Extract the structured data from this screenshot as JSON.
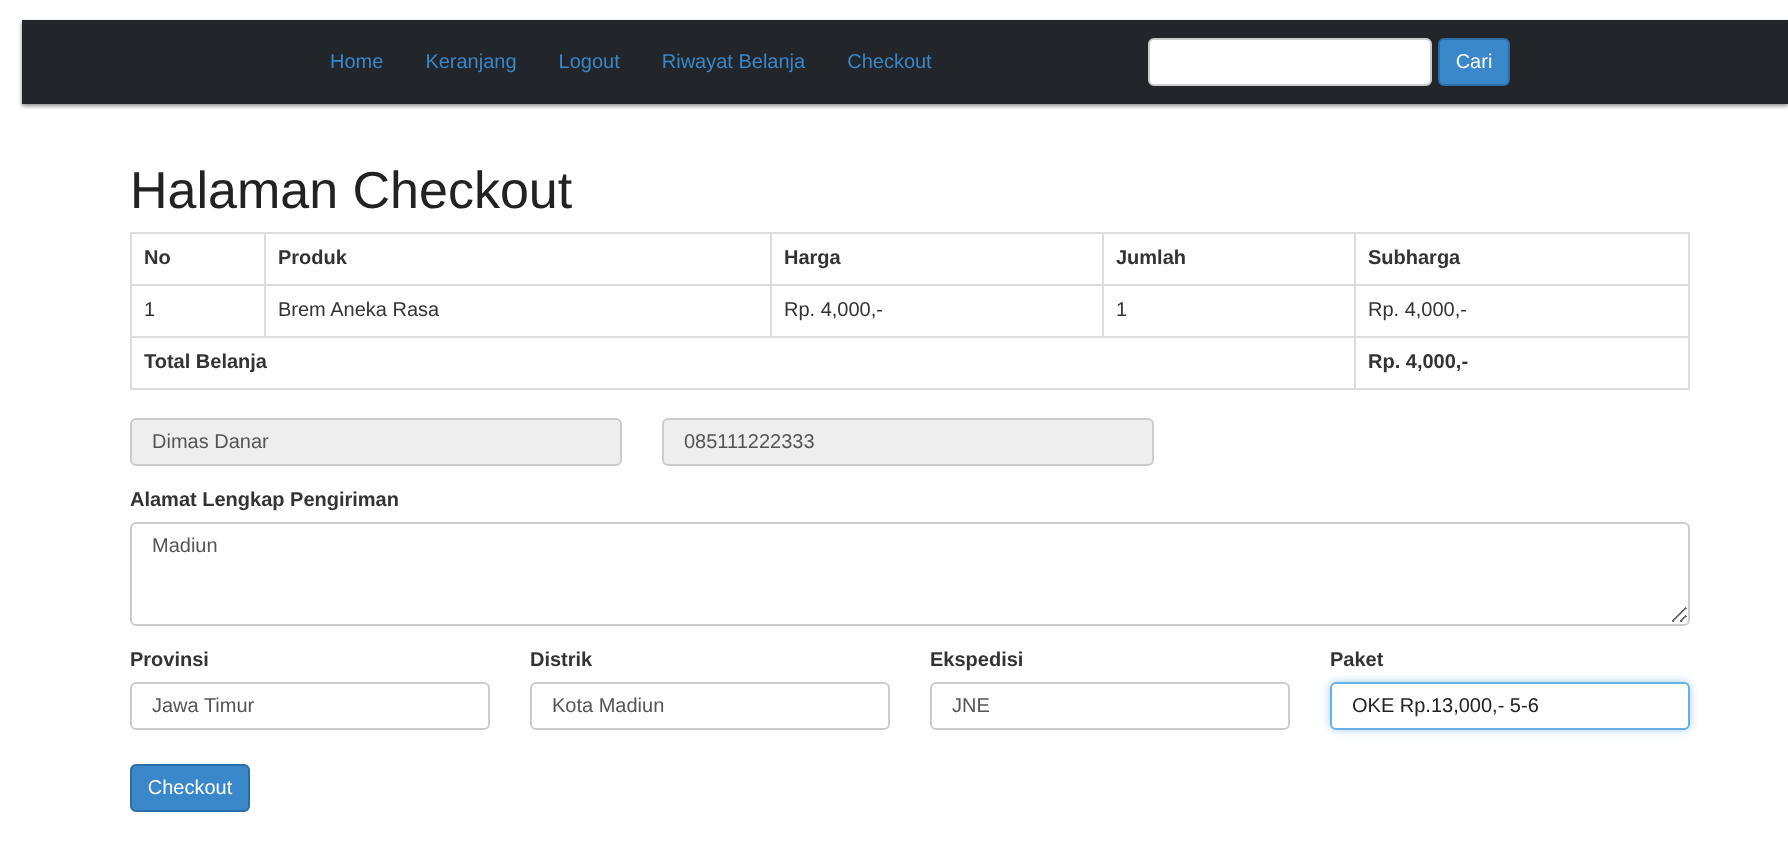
{
  "navbar": {
    "links": [
      "Home",
      "Keranjang",
      "Logout",
      "Riwayat Belanja",
      "Checkout"
    ],
    "search": {
      "button": "Cari"
    }
  },
  "title": "Halaman Checkout",
  "table": {
    "columns": [
      "No",
      "Produk",
      "Harga",
      "Jumlah",
      "Subharga"
    ],
    "rows": [
      [
        "1",
        "Brem Aneka Rasa",
        "Rp. 4,000,-",
        "1",
        "Rp. 4,000,-"
      ]
    ],
    "total": {
      "label": "Total Belanja",
      "value": "Rp. 4,000,-"
    }
  },
  "contact_fields": [
    {
      "value": "Dimas Danar",
      "disabled": true
    },
    {
      "value": "085111222333",
      "disabled": true
    }
  ],
  "address": {
    "label": "Alamat Lengkap Pengiriman",
    "value": "Madiun"
  },
  "shipping_fields": [
    {
      "label": "Provinsi",
      "value": "Jawa Timur",
      "focused": false
    },
    {
      "label": "Distrik",
      "value": "Kota Madiun",
      "focused": false
    },
    {
      "label": "Ekspedisi",
      "value": "JNE",
      "focused": false
    },
    {
      "label": "Paket",
      "value": "OKE Rp.13,000,- 5-6",
      "focused": true
    }
  ],
  "submit_button": "Checkout"
}
